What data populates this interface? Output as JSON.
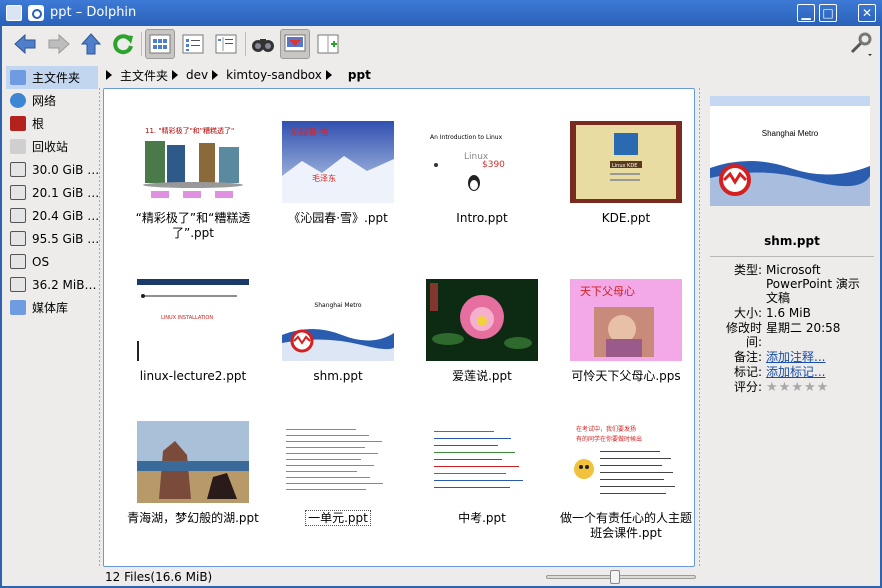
{
  "window": {
    "title": "ppt – Dolphin"
  },
  "toolbar": {
    "buttons": [
      "back-icon",
      "forward-icon",
      "up-icon",
      "reload-icon",
      "icons-view-icon",
      "details-view-icon",
      "columns-view-icon",
      "find-icon",
      "preview-icon",
      "split-icon",
      "settings-icon"
    ],
    "active": [
      "icons-view-icon",
      "preview-icon"
    ]
  },
  "sidebar": {
    "items": [
      {
        "label": "主文件夹",
        "icon": "home-folder-icon",
        "selected": true
      },
      {
        "label": "网络",
        "icon": "network-icon"
      },
      {
        "label": "根",
        "icon": "root-folder-icon"
      },
      {
        "label": "回收站",
        "icon": "trash-icon"
      },
      {
        "label": "30.0 GiB …",
        "icon": "drive-icon"
      },
      {
        "label": "20.1 GiB …",
        "icon": "drive-icon"
      },
      {
        "label": "20.4 GiB …",
        "icon": "drive-icon"
      },
      {
        "label": "95.5 GiB …",
        "icon": "drive-icon"
      },
      {
        "label": "OS",
        "icon": "drive-icon"
      },
      {
        "label": "36.2 MiB…",
        "icon": "drive-icon"
      },
      {
        "label": "媒体库",
        "icon": "folder-icon"
      }
    ]
  },
  "breadcrumb": {
    "items": [
      "主文件夹",
      "dev",
      "kimtoy-sandbox"
    ],
    "current": "ppt"
  },
  "files": [
    {
      "name": "“精彩极了”和“糟糕透了”.ppt"
    },
    {
      "name": "《沁园春·雪》.ppt"
    },
    {
      "name": "Intro.ppt"
    },
    {
      "name": "KDE.ppt"
    },
    {
      "name": "linux-lecture2.ppt"
    },
    {
      "name": "shm.ppt"
    },
    {
      "name": "爱莲说.ppt"
    },
    {
      "name": "可怜天下父母心.pps"
    },
    {
      "name": "青海湖，梦幻般的湖.ppt"
    },
    {
      "name": "一单元.ppt"
    },
    {
      "name": "中考.ppt"
    },
    {
      "name": "做一个有责任心的人主题班会课件.ppt"
    }
  ],
  "thumbs": {
    "t1": "11. \"精彩极了\"和\"糟糕透了\"",
    "t2": "沁园春·雪",
    "t2b": "毛泽东",
    "t3": "An Introduction to Linux",
    "t3b": "Linux",
    "t3c": "$390",
    "t4": "Linux KDE",
    "t5": "LINUX INSTALLATION",
    "t6": "Shanghai Metro",
    "t8": "天下父母心",
    "t12": "在考试中，我们要发扬",
    "t12b": "有的同学在你要做时候出"
  },
  "info": {
    "preview_title": "Shanghai Metro",
    "name": "shm.ppt",
    "meta": [
      {
        "k": "类型:",
        "v": "Microsoft PowerPoint 演示文稿"
      },
      {
        "k": "大小:",
        "v": "1.6 MiB"
      },
      {
        "k": "修改时间:",
        "v": "星期二 20:58"
      },
      {
        "k": "备注:",
        "v": "添加注释...",
        "link": true
      },
      {
        "k": "标记:",
        "v": "添加标记...",
        "link": true
      },
      {
        "k": "评分:",
        "v": ""
      }
    ],
    "rating": 0
  },
  "status": {
    "text": "12 Files(16.6 MiB)",
    "zoom": 0.45
  },
  "colors": {
    "titlebar": "#2a61b8",
    "selection": "#c3d6ef",
    "link": "#1a4ea8"
  }
}
